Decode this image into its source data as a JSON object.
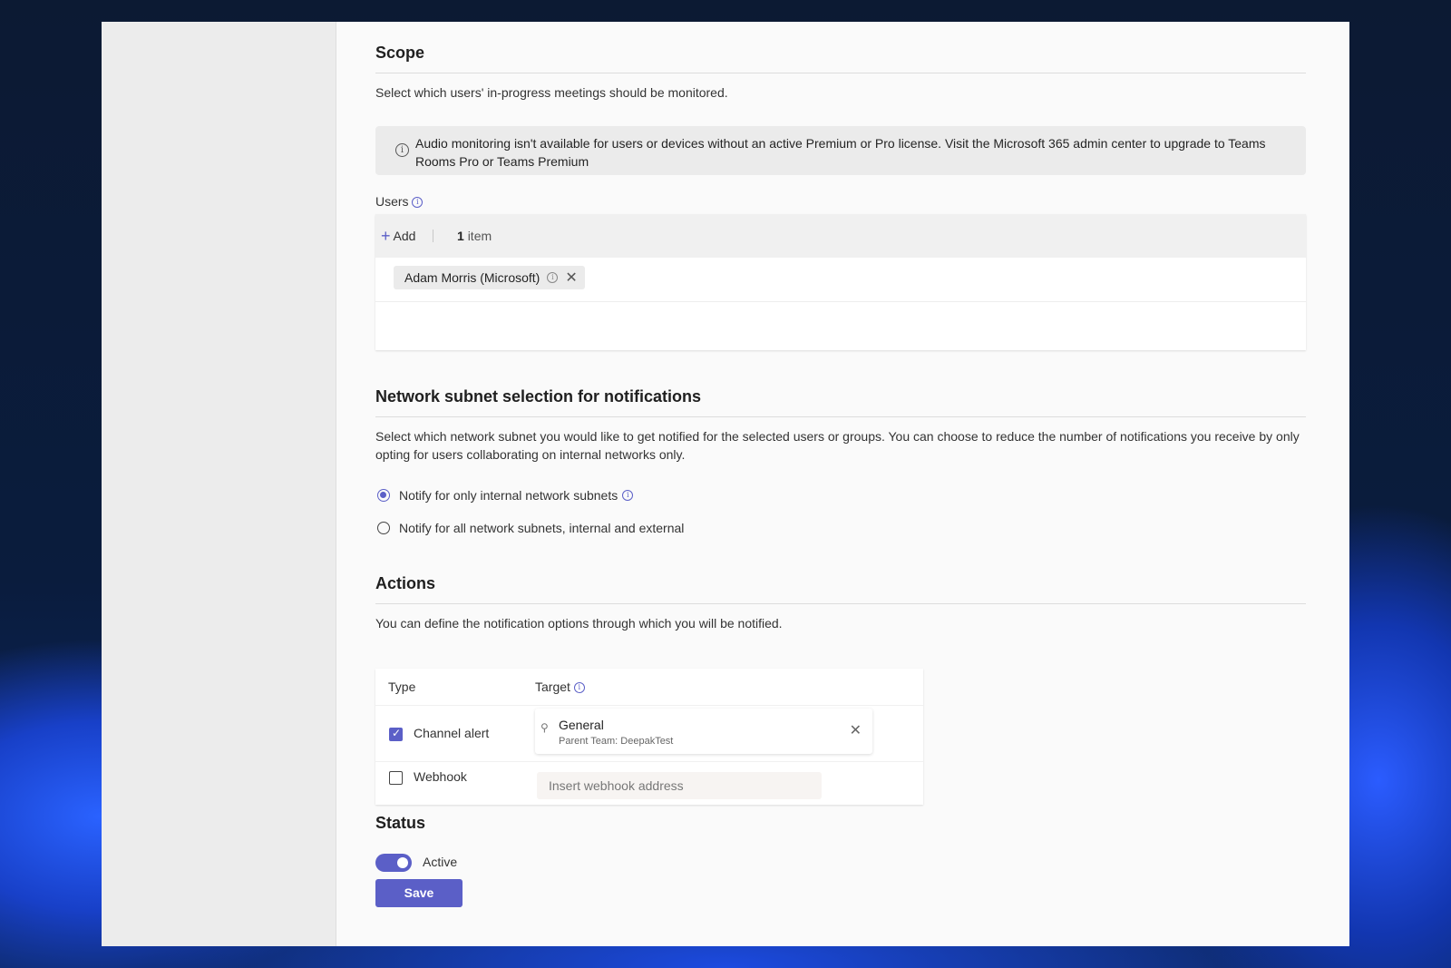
{
  "scope": {
    "title": "Scope",
    "description": "Select which users' in-progress meetings should be monitored.",
    "banner_text": "Audio monitoring isn't available for users or devices without an active Premium or Pro license. Visit the Microsoft 365 admin center to upgrade to Teams Rooms Pro or Teams Premium",
    "users_label": "Users",
    "add_label": "Add",
    "item_count_number": "1",
    "item_count_word": "item",
    "users": [
      {
        "name": "Adam Morris (Microsoft)"
      }
    ]
  },
  "network": {
    "title": "Network subnet selection for notifications",
    "description": "Select which network subnet you would like to get notified for the selected users or groups. You can choose to reduce the number of notifications you receive by only opting for users collaborating on internal networks only.",
    "options": [
      {
        "label": "Notify for only internal network subnets",
        "selected": true
      },
      {
        "label": "Notify for all network subnets, internal and external",
        "selected": false
      }
    ]
  },
  "actions": {
    "title": "Actions",
    "description": "You can define the notification options through which you will be notified.",
    "columns": [
      "Type",
      "Target"
    ],
    "channel_alert": {
      "label": "Channel alert",
      "checked": true,
      "target_name": "General",
      "target_sub": "Parent Team: DeepakTest"
    },
    "webhook": {
      "label": "Webhook",
      "checked": false,
      "placeholder": "Insert webhook address"
    }
  },
  "status": {
    "title": "Status",
    "toggle_label": "Active",
    "toggle_on": true,
    "save_label": "Save"
  },
  "colors": {
    "accent": "#5b5fc7"
  }
}
